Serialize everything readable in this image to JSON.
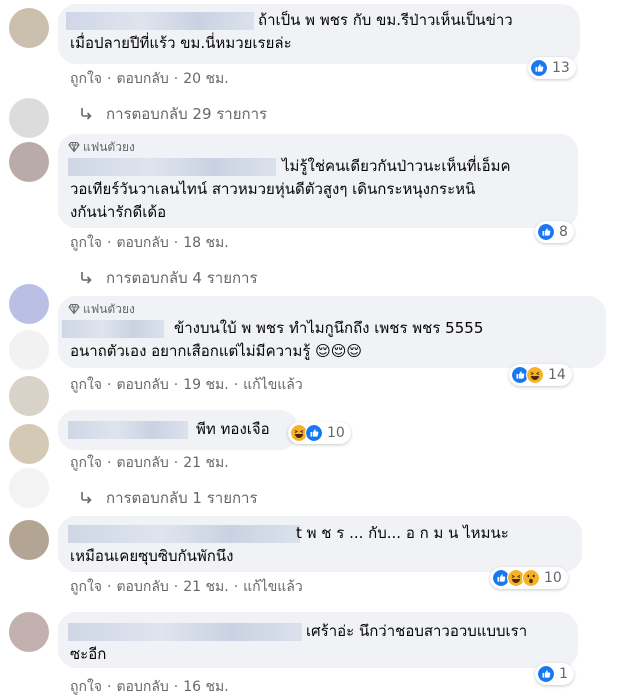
{
  "comments": [
    {
      "lines": [
        "ถ้าเป็น พ พชร กับ ขม.รีป่าวเห็นเป็นข่าว",
        "เมื่อปลายปีที่แร้ว ขม.นี่หมวยเรยล่ะ"
      ],
      "like_label": "ถูกใจ",
      "reply_label": "ตอบกลับ",
      "time": "20 ชม.",
      "reaction_count": "13",
      "replies_label": "การตอบกลับ 29 รายการ"
    },
    {
      "badge": "แฟนตัวยง",
      "lines": [
        "ไม่รู้ใช่คนเดียวกันป่าวนะเห็นที่เอ็มค",
        "วอเทียร์วันวาเลนไทน์ สาวหมวยหุ่นดีตัวสูงๆ เดินกระหนุงกระหนิ",
        "งกันน่ารักดีเด้อ"
      ],
      "like_label": "ถูกใจ",
      "reply_label": "ตอบกลับ",
      "time": "18 ชม.",
      "reaction_count": "8",
      "replies_label": "การตอบกลับ 4 รายการ"
    },
    {
      "badge": "แฟนตัวยง",
      "lines": [
        "ข้างบนใบ้ พ พชร ทำไมกูนึกถึง เพชร พชร 5555",
        "อนาถตัวเอง อยากเสือกแต่ไม่มีความรู้ 😌😌😌"
      ],
      "like_label": "ถูกใจ",
      "reply_label": "ตอบกลับ",
      "time": "19 ชม.",
      "edited_label": "แก้ไขแล้ว",
      "reaction_count": "14"
    },
    {
      "lines": [
        "พีท ทองเจือ"
      ],
      "like_label": "ถูกใจ",
      "reply_label": "ตอบกลับ",
      "time": "21 ชม.",
      "reaction_count": "10",
      "replies_label": "การตอบกลับ 1 รายการ"
    },
    {
      "lines": [
        "t พ ช ร ... กับ... อ ก ม น ไหมนะ",
        "เหมือนเคยซุบซิบกันพักนึง"
      ],
      "like_label": "ถูกใจ",
      "reply_label": "ตอบกลับ",
      "time": "21 ชม.",
      "edited_label": "แก้ไขแล้ว",
      "reaction_count": "10"
    },
    {
      "lines": [
        "เศร้าอ่ะ นึกว่าชอบสาวอวบแบบเรา",
        "ซะอีก"
      ],
      "like_label": "ถูกใจ",
      "reply_label": "ตอบกลับ",
      "time": "16 ชม.",
      "reaction_count": "1"
    }
  ],
  "colors": {
    "bubble": "#f0f2f5",
    "meta": "#65676b",
    "like_blue": "#1877f2",
    "haha_yellow": "#f7b125"
  }
}
